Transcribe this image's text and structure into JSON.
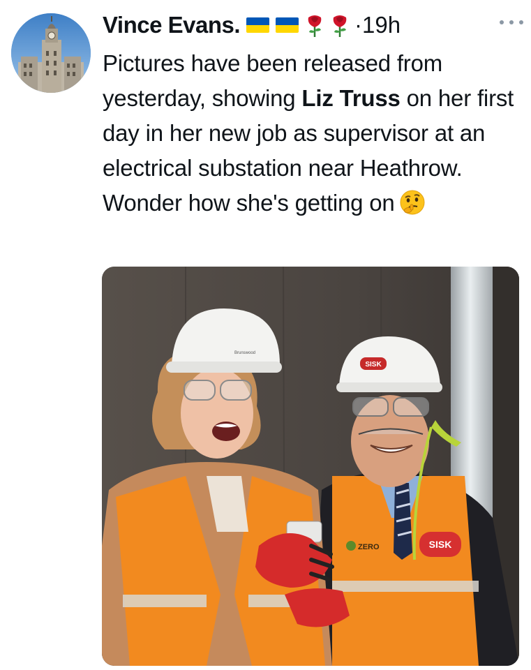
{
  "author": {
    "display_name": "Vince Evans.",
    "flags": [
      "ukraine-flag",
      "ukraine-flag"
    ],
    "roses": [
      "rose-emoji",
      "rose-emoji"
    ],
    "time_separator": "·",
    "time": "19h",
    "more_icon": "more-dots-icon"
  },
  "tweet": {
    "text_before": "Pictures have been released from yesterday, showing ",
    "bold": "Liz Truss",
    "text_after": " on her first day in her new job as supervisor at an electrical substation near Heathrow. Wonder how she's getting on",
    "emoji": "thinking-face-emoji"
  },
  "photo": {
    "helmet_label": "SISK",
    "vest_logo": "SISK",
    "vest_zero": "ZERO",
    "helmet_brand": "Brunswood"
  },
  "colors": {
    "ukraine_blue": "#0057b7",
    "ukraine_yellow": "#ffd700",
    "rose_red": "#d0142a",
    "hi_vis_orange": "#f28a1f"
  }
}
